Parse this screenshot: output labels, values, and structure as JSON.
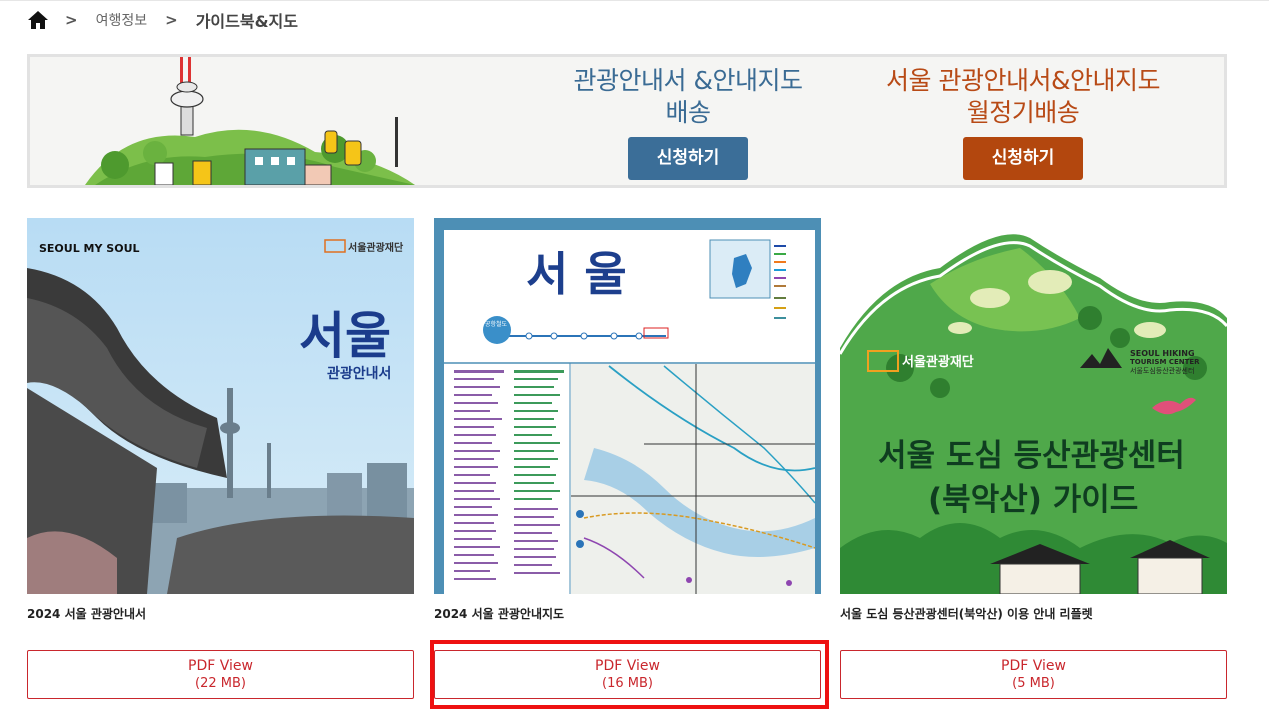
{
  "breadcrumb": {
    "items": [
      "여행정보",
      "가이드북&지도"
    ],
    "separator": ">"
  },
  "banner": {
    "delivery": {
      "title_line1": "관광안내서 &안내지도",
      "title_line2": "배송",
      "button": "신청하기",
      "color": "#3b6e98"
    },
    "monthly": {
      "title_line1": "서울 관광안내서&안내지도",
      "title_line2": "월정기배송",
      "button": "신청하기",
      "color": "#b3470e"
    }
  },
  "cards": [
    {
      "title": "2024 서울 관광안내서",
      "pdf_label": "PDF View",
      "pdf_size": "(22 MB)",
      "cover": {
        "brand": "SEOUL MY SOUL",
        "org": "서울관광재단",
        "big": "서울",
        "sub": "관광안내서"
      }
    },
    {
      "title": "2024 서울 관광안내지도",
      "pdf_label": "PDF View",
      "pdf_size": "(16 MB)",
      "cover": {
        "big": "서 울",
        "badge": "공항철도"
      }
    },
    {
      "title": "서울 도심 등산관광센터(북악산) 이용 안내 리플렛",
      "pdf_label": "PDF View",
      "pdf_size": "(5 MB)",
      "cover": {
        "org": "서울관광재단",
        "center_en1": "SEOUL HIKING",
        "center_en2": "TOURISM CENTER",
        "center_ko": "서울도심등산관광센터",
        "line1": "서울 도심 등산관광센터",
        "line2": "(북악산) 가이드"
      }
    }
  ],
  "colors": {
    "accent_red": "#c9272d",
    "highlight": "#ee1111"
  }
}
